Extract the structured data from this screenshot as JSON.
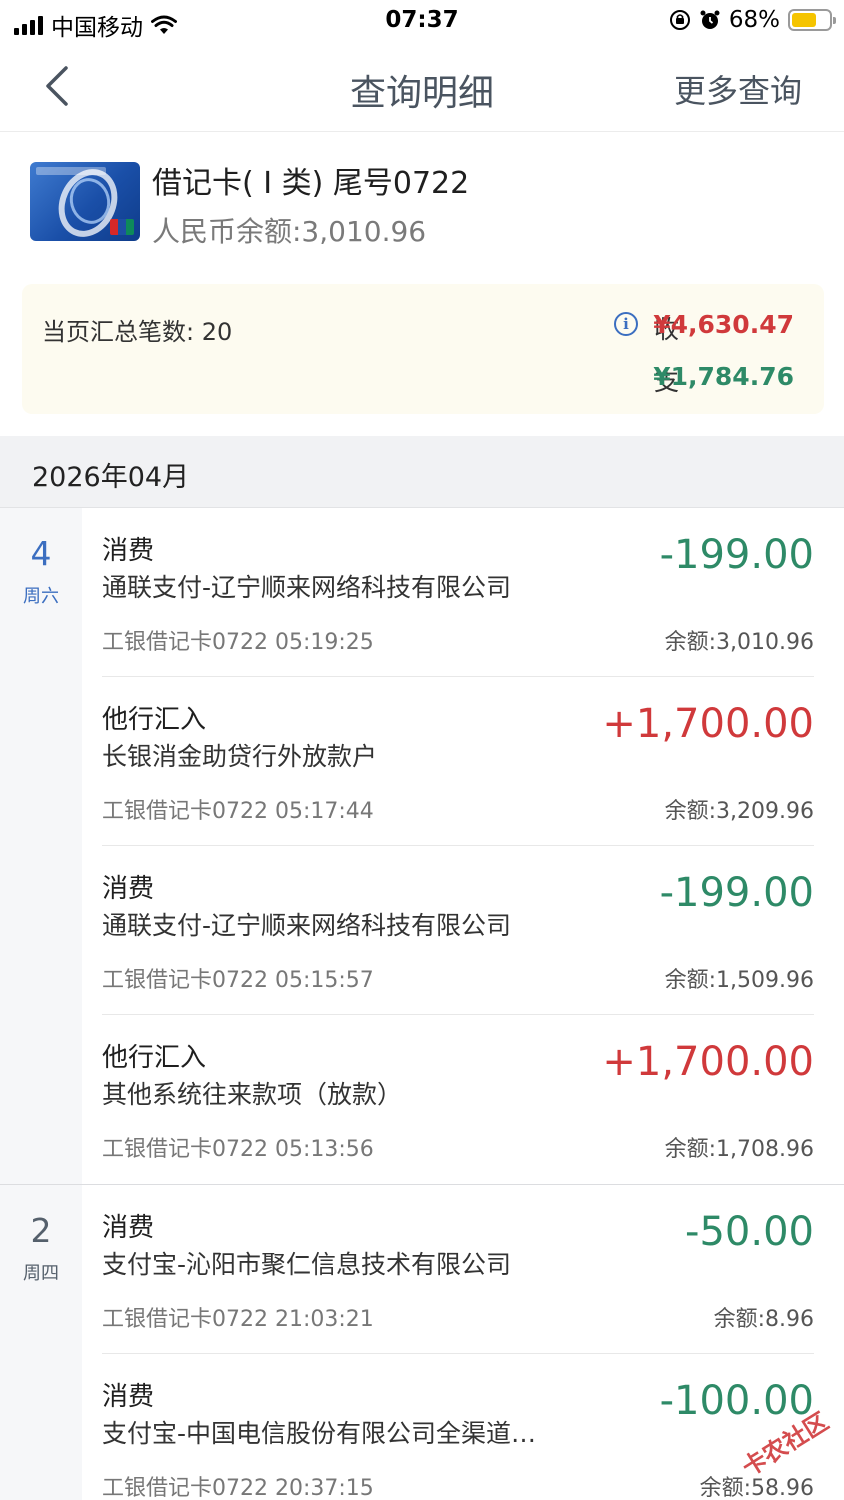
{
  "status_bar": {
    "carrier": "中国移动",
    "time": "07:37",
    "battery_percent": "68%",
    "battery_level": 0.68,
    "battery_color": "#f5c400"
  },
  "nav": {
    "back_icon": "chevron-left-icon",
    "title": "查询明细",
    "more": "更多查询"
  },
  "account": {
    "name": "借记卡( I 类) 尾号0722",
    "balance": "人民币余额:3,010.96"
  },
  "summary": {
    "count": "当页汇总笔数: 20",
    "income_label": "收",
    "income_amount": "¥4,630.47",
    "expense_label": "支",
    "expense_amount": "¥1,784.76"
  },
  "month": "2026年04月",
  "groups": [
    {
      "day": "4",
      "weekday": "周六",
      "transactions": [
        {
          "type": "消费",
          "desc": "通联支付-辽宁顺来网络科技有限公司",
          "amount": "-199.00",
          "direction": "out",
          "card_time": "工银借记卡0722 05:19:25",
          "balance": "余额:3,010.96"
        },
        {
          "type": "他行汇入",
          "desc": "长银消金助贷行外放款户",
          "amount": "+1,700.00",
          "direction": "in",
          "card_time": "工银借记卡0722 05:17:44",
          "balance": "余额:3,209.96"
        },
        {
          "type": "消费",
          "desc": "通联支付-辽宁顺来网络科技有限公司",
          "amount": "-199.00",
          "direction": "out",
          "card_time": "工银借记卡0722 05:15:57",
          "balance": "余额:1,509.96"
        },
        {
          "type": "他行汇入",
          "desc": "其他系统往来款项（放款）",
          "amount": "+1,700.00",
          "direction": "in",
          "card_time": "工银借记卡0722 05:13:56",
          "balance": "余额:1,708.96"
        }
      ]
    },
    {
      "day": "2",
      "weekday": "周四",
      "transactions": [
        {
          "type": "消费",
          "desc": "支付宝-沁阳市聚仁信息技术有限公司",
          "amount": "-50.00",
          "direction": "out",
          "card_time": "工银借记卡0722 21:03:21",
          "balance": "余额:8.96"
        },
        {
          "type": "消费",
          "desc": "支付宝-中国电信股份有限公司全渠道…",
          "amount": "-100.00",
          "direction": "out",
          "card_time": "工银借记卡0722 20:37:15",
          "balance": "余额:58.96"
        }
      ]
    }
  ],
  "watermark": "卡农社区",
  "colors": {
    "income": "#d0393b",
    "expense": "#2e8a67",
    "accent": "#3b6ec0"
  }
}
